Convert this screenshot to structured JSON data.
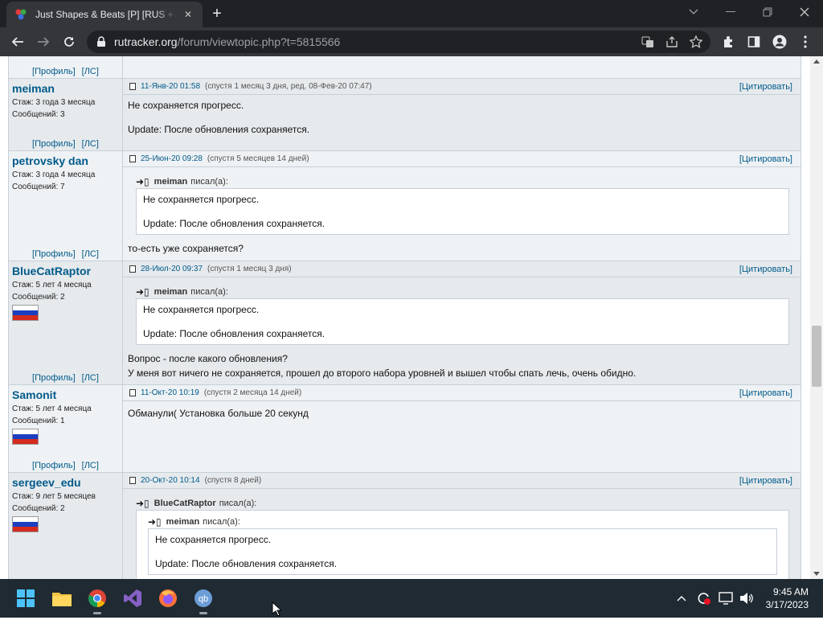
{
  "browser": {
    "tab_title": "Just Shapes & Beats [P] [RUS + ENG]",
    "url_host": "rutracker.org",
    "url_path": "/forum/viewtopic.php?t=5815566"
  },
  "forum": {
    "prof_label": "[Профиль]",
    "pm_label": "[ЛС]",
    "quote_label": "[Цитировать]",
    "wrote_suffix": "писал(а):",
    "posts": [
      {
        "nick": "meiman",
        "stazh": "Стаж: 3 года 3 месяца",
        "messages": "Сообщений: 3",
        "date": "11-Янв-20 01:58",
        "info": "(спустя 1 месяц 3 дня, ред. 08-Фев-20 07:47)",
        "text1": "Не сохраняется прогресс.",
        "text2": "Update: После обновления сохраняется."
      },
      {
        "nick": "petrovsky dan",
        "stazh": "Стаж: 3 года 4 месяца",
        "messages": "Сообщений: 7",
        "date": "25-Июн-20 09:28",
        "info": "(спустя 5 месяцев 14 дней)",
        "q_author": "meiman",
        "q1": "Не сохраняется прогресс.",
        "q2": "Update: После обновления сохраняется.",
        "text1": "то-есть уже сохраняется?"
      },
      {
        "nick": "BlueCatRaptor",
        "stazh": "Стаж: 5 лет 4 месяца",
        "messages": "Сообщений: 2",
        "date": "28-Июл-20 09:37",
        "info": "(спустя 1 месяц 3 дня)",
        "q_author": "meiman",
        "q1": "Не сохраняется прогресс.",
        "q2": "Update: После обновления сохраняется.",
        "text1": "Вопрос - после какого обновления?",
        "text2": "У меня вот ничего не сохраняется, прошел до второго набора уровней и вышел чтобы спать лечь, очень обидно."
      },
      {
        "nick": "Samonit",
        "stazh": "Стаж: 5 лет 4 месяца",
        "messages": "Сообщений: 1",
        "date": "11-Окт-20 10:19",
        "info": "(спустя 2 месяца 14 дней)",
        "text1": "Обманули( Установка больше 20 секунд"
      },
      {
        "nick": "sergeev_edu",
        "stazh": "Стаж: 9 лет 5 месяцев",
        "messages": "Сообщений: 2",
        "date": "20-Окт-20 10:14",
        "info": "(спустя 8 дней)",
        "q_author": "BlueCatRaptor",
        "qq_author": "meiman",
        "q1": "Не сохраняется прогресс.",
        "q2": "Update: После обновления сохраняется."
      }
    ]
  },
  "taskbar": {
    "time": "9:45 AM",
    "date": "3/17/2023"
  },
  "colors": {
    "link": "#005a8a",
    "post_alt": "#e6eaed",
    "post_norm": "#eff2f4",
    "taskbar": "#1f2a33"
  }
}
